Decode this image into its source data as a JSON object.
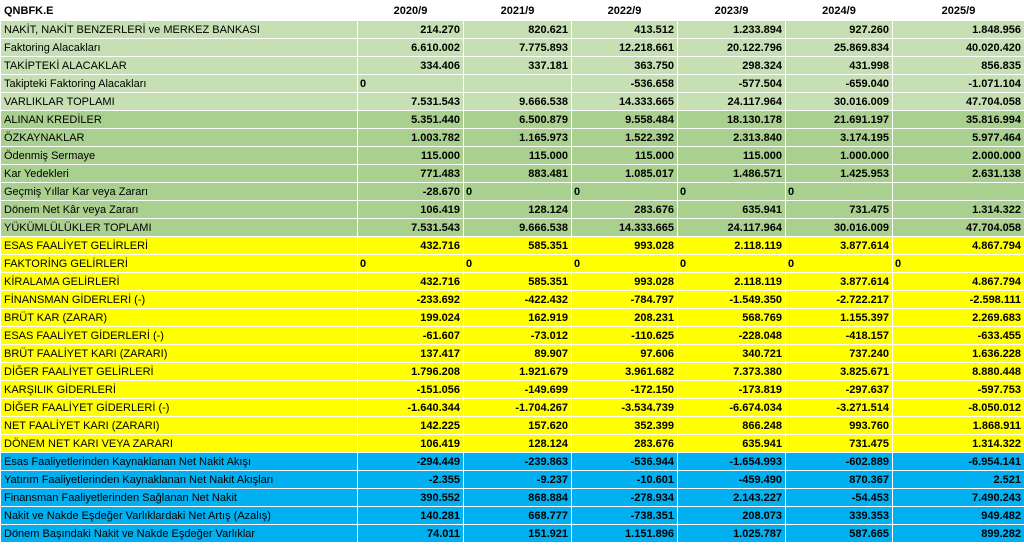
{
  "header": {
    "ticker": "QNBFK.E",
    "years": [
      "2020/9",
      "2021/9",
      "2022/9",
      "2023/9",
      "2024/9",
      "2025/9"
    ]
  },
  "sections": [
    {
      "name": "light",
      "rows": [
        {
          "label": "NAKİT, NAKİT BENZERLERİ ve MERKEZ BANKASI",
          "values": [
            "214.270",
            "820.621",
            "413.512",
            "1.233.894",
            "927.260",
            "1.848.956"
          ]
        },
        {
          "label": "Faktoring Alacakları",
          "values": [
            "6.610.002",
            "7.775.893",
            "12.218.661",
            "20.122.796",
            "25.869.834",
            "40.020.420"
          ]
        },
        {
          "label": "TAKİPTEKİ ALACAKLAR",
          "values": [
            "334.406",
            "337.181",
            "363.750",
            "298.324",
            "431.998",
            "856.835"
          ]
        },
        {
          "label": "Takipteki Faktoring Alacakları",
          "values": [
            "0",
            "",
            "-536.658",
            "-577.504",
            "-659.040",
            "-1.071.104"
          ],
          "zeros": [
            0
          ]
        },
        {
          "label": "VARLIKLAR TOPLAMI",
          "values": [
            "7.531.543",
            "9.666.538",
            "14.333.665",
            "24.117.964",
            "30.016.009",
            "47.704.058"
          ]
        }
      ]
    },
    {
      "name": "mid",
      "rows": [
        {
          "label": "ALINAN KREDİLER",
          "values": [
            "5.351.440",
            "6.500.879",
            "9.558.484",
            "18.130.178",
            "21.691.197",
            "35.816.994"
          ]
        },
        {
          "label": "ÖZKAYNAKLAR",
          "values": [
            "1.003.782",
            "1.165.973",
            "1.522.392",
            "2.313.840",
            "3.174.195",
            "5.977.464"
          ]
        },
        {
          "label": "Ödenmiş Sermaye",
          "values": [
            "115.000",
            "115.000",
            "115.000",
            "115.000",
            "1.000.000",
            "2.000.000"
          ]
        },
        {
          "label": "Kar Yedekleri",
          "values": [
            "771.483",
            "883.481",
            "1.085.017",
            "1.486.571",
            "1.425.953",
            "2.631.138"
          ]
        },
        {
          "label": "Geçmiş Yıllar Kar veya Zararı",
          "values": [
            "-28.670",
            "0",
            "0",
            "0",
            "0",
            ""
          ],
          "zeros": [
            1,
            2,
            3,
            4
          ]
        },
        {
          "label": "Dönem Net Kâr veya Zararı",
          "values": [
            "106.419",
            "128.124",
            "283.676",
            "635.941",
            "731.475",
            "1.314.322"
          ]
        },
        {
          "label": "YÜKÜMLÜLÜKLER TOPLAMI",
          "values": [
            "7.531.543",
            "9.666.538",
            "14.333.665",
            "24.117.964",
            "30.016.009",
            "47.704.058"
          ]
        }
      ]
    },
    {
      "name": "yel",
      "rows": [
        {
          "label": "ESAS FAALİYET GELİRLERİ",
          "values": [
            "432.716",
            "585.351",
            "993.028",
            "2.118.119",
            "3.877.614",
            "4.867.794"
          ]
        },
        {
          "label": "FAKTORİNG GELİRLERİ",
          "values": [
            "0",
            "0",
            "0",
            "0",
            "0",
            "0"
          ],
          "zeros": [
            0,
            1,
            2,
            3,
            4,
            5
          ]
        },
        {
          "label": "KİRALAMA GELİRLERİ",
          "values": [
            "432.716",
            "585.351",
            "993.028",
            "2.118.119",
            "3.877.614",
            "4.867.794"
          ]
        },
        {
          "label": "FİNANSMAN GİDERLERİ (-)",
          "values": [
            "-233.692",
            "-422.432",
            "-784.797",
            "-1.549.350",
            "-2.722.217",
            "-2.598.111"
          ]
        },
        {
          "label": "BRÜT KAR (ZARAR)",
          "values": [
            "199.024",
            "162.919",
            "208.231",
            "568.769",
            "1.155.397",
            "2.269.683"
          ]
        },
        {
          "label": "ESAS FAALİYET GİDERLERİ (-)",
          "values": [
            "-61.607",
            "-73.012",
            "-110.625",
            "-228.048",
            "-418.157",
            "-633.455"
          ]
        },
        {
          "label": "BRÜT FAALİYET KARI (ZARARI)",
          "values": [
            "137.417",
            "89.907",
            "97.606",
            "340.721",
            "737.240",
            "1.636.228"
          ]
        },
        {
          "label": "DİĞER FAALİYET GELİRLERİ",
          "values": [
            "1.796.208",
            "1.921.679",
            "3.961.682",
            "7.373.380",
            "3.825.671",
            "8.880.448"
          ]
        },
        {
          "label": "KARŞILIK GİDERLERİ",
          "values": [
            "-151.056",
            "-149.699",
            "-172.150",
            "-173.819",
            "-297.637",
            "-597.753"
          ]
        },
        {
          "label": "DİĞER FAALİYET GİDERLERİ (-)",
          "values": [
            "-1.640.344",
            "-1.704.267",
            "-3.534.739",
            "-6.674.034",
            "-3.271.514",
            "-8.050.012"
          ]
        },
        {
          "label": "NET FAALİYET KARI (ZARARI)",
          "values": [
            "142.225",
            "157.620",
            "352.399",
            "866.248",
            "993.760",
            "1.868.911"
          ]
        },
        {
          "label": "DÖNEM NET KARI VEYA ZARARI",
          "values": [
            "106.419",
            "128.124",
            "283.676",
            "635.941",
            "731.475",
            "1.314.322"
          ]
        }
      ]
    },
    {
      "name": "blue",
      "rows": [
        {
          "label": "Esas Faaliyetlerinden Kaynaklanan Net Nakit Akışı",
          "values": [
            "-294.449",
            "-239.863",
            "-536.944",
            "-1.654.993",
            "-602.889",
            "-6.954.141"
          ]
        },
        {
          "label": "Yatırım Faaliyetlerinden Kaynaklanan Net Nakit Akışları",
          "values": [
            "-2.355",
            "-9.237",
            "-10.601",
            "-459.490",
            "870.367",
            "2.521"
          ]
        },
        {
          "label": "Finansman Faaliyetlerinden Sağlanan Net Nakit",
          "values": [
            "390.552",
            "868.884",
            "-278.934",
            "2.143.227",
            "-54.453",
            "7.490.243"
          ]
        },
        {
          "label": "Nakit ve Nakde Eşdeğer Varlıklardaki Net Artış (Azalış)",
          "values": [
            "140.281",
            "668.777",
            "-738.351",
            "208.073",
            "339.353",
            "949.482"
          ]
        },
        {
          "label": "Dönem Başındaki Nakit ve Nakde Eşdeğer Varlıklar",
          "values": [
            "74.011",
            "151.921",
            "1.151.896",
            "1.025.787",
            "587.665",
            "899.282"
          ]
        }
      ]
    }
  ]
}
